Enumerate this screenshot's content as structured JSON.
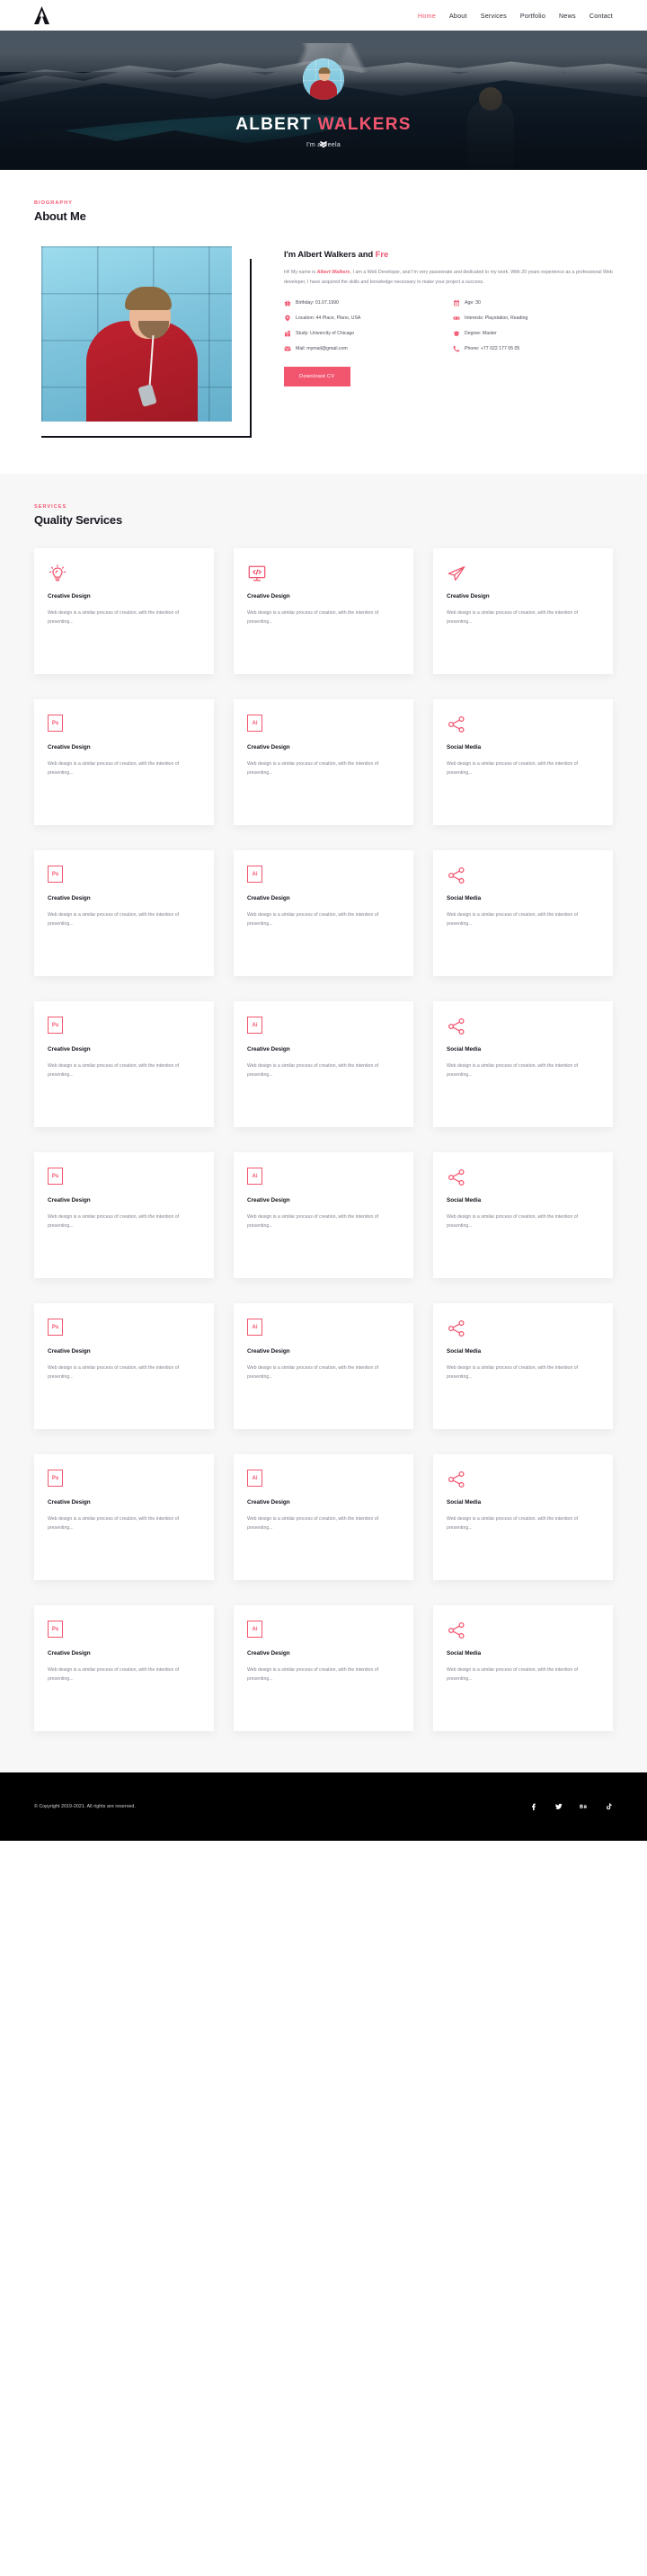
{
  "nav": {
    "logo_icon": "letter-a-logo-icon",
    "links": [
      {
        "label": "Home",
        "active": true
      },
      {
        "label": "About",
        "active": false
      },
      {
        "label": "Services",
        "active": false
      },
      {
        "label": "Portfolio",
        "active": false
      },
      {
        "label": "News",
        "active": false
      },
      {
        "label": "Contact",
        "active": false
      }
    ]
  },
  "hero": {
    "avatar_alt": "portrait-avatar",
    "title_first": "ALBERT ",
    "title_accent": "WALKERS",
    "subtitle": "I'm aFreela",
    "scroll_icon": "chevron-double-down-icon"
  },
  "about": {
    "eyebrow": "BIOGRAPHY",
    "title": "About Me",
    "heading_plain": "I'm Albert Walkers and ",
    "heading_accent": "Fre",
    "paragraph_lead": "Hi! My name is ",
    "paragraph_name": "Albert Walkers",
    "paragraph_rest": ", I am a Web Developer, and I'm very passionate and dedicated to my work. With 20 years experience as a professional Web developer, I have acquired the skills and knowledge necessary to make your project a success.",
    "info": [
      {
        "icon": "gift-icon",
        "label": "Birthday: 01.07.1990"
      },
      {
        "icon": "calendar-icon",
        "label": "Age: 30"
      },
      {
        "icon": "map-pin-icon",
        "label": "Location: 44 Place, Plano, USA"
      },
      {
        "icon": "gamepad-icon",
        "label": "Interests: Playstation, Reading"
      },
      {
        "icon": "building-icon",
        "label": "Study: Univercity of Chicago"
      },
      {
        "icon": "graduation-cap-icon",
        "label": "Degree: Master"
      },
      {
        "icon": "envelope-icon",
        "label": "Mail: mymail@gmail.com"
      },
      {
        "icon": "phone-icon",
        "label": "Phone: +77 022 177 05 05"
      }
    ],
    "cv_button": "Downlowd CV"
  },
  "services": {
    "eyebrow": "SERVICES",
    "title": "Quality Services",
    "rows": [
      [
        {
          "icon": "lightbulb-icon",
          "title": "Creative Design",
          "text": "Web design is a similar process of creation, with the intention of presenting..."
        },
        {
          "icon": "code-monitor-icon",
          "title": "Creative Design",
          "text": "Web design is a similar process of creation, with the intention of presenting..."
        },
        {
          "icon": "paper-plane-icon",
          "title": "Creative Design",
          "text": "Web design is a similar process of creation, with the intention of presenting..."
        }
      ],
      [
        {
          "icon": "photoshop-icon",
          "title": "Creative Design",
          "text": "Web design is a similar process of creation, with the intention of presenting..."
        },
        {
          "icon": "illustrator-icon",
          "title": "Creative Design",
          "text": "Web design is a similar process of creation, with the intention of presenting..."
        },
        {
          "icon": "share-icon",
          "title": "Social Media",
          "text": "Web design is a similar process of creation, with the intention of presenting..."
        }
      ],
      [
        {
          "icon": "photoshop-icon",
          "title": "Creative Design",
          "text": "Web design is a similar process of creation, with the intention of presenting..."
        },
        {
          "icon": "illustrator-icon",
          "title": "Creative Design",
          "text": "Web design is a similar process of creation, with the intention of presenting..."
        },
        {
          "icon": "share-icon",
          "title": "Social Media",
          "text": "Web design is a similar process of creation, with the intention of presenting..."
        }
      ],
      [
        {
          "icon": "photoshop-icon",
          "title": "Creative Design",
          "text": "Web design is a similar process of creation, with the intention of presenting..."
        },
        {
          "icon": "illustrator-icon",
          "title": "Creative Design",
          "text": "Web design is a similar process of creation, with the intention of presenting..."
        },
        {
          "icon": "share-icon",
          "title": "Social Media",
          "text": "Web design is a similar process of creation, with the intention of presenting..."
        }
      ],
      [
        {
          "icon": "photoshop-icon",
          "title": "Creative Design",
          "text": "Web design is a similar process of creation, with the intention of presenting..."
        },
        {
          "icon": "illustrator-icon",
          "title": "Creative Design",
          "text": "Web design is a similar process of creation, with the intention of presenting..."
        },
        {
          "icon": "share-icon",
          "title": "Social Media",
          "text": "Web design is a similar process of creation, with the intention of presenting..."
        }
      ],
      [
        {
          "icon": "photoshop-icon",
          "title": "Creative Design",
          "text": "Web design is a similar process of creation, with the intention of presenting..."
        },
        {
          "icon": "illustrator-icon",
          "title": "Creative Design",
          "text": "Web design is a similar process of creation, with the intention of presenting..."
        },
        {
          "icon": "share-icon",
          "title": "Social Media",
          "text": "Web design is a similar process of creation, with the intention of presenting..."
        }
      ],
      [
        {
          "icon": "photoshop-icon",
          "title": "Creative Design",
          "text": "Web design is a similar process of creation, with the intention of presenting..."
        },
        {
          "icon": "illustrator-icon",
          "title": "Creative Design",
          "text": "Web design is a similar process of creation, with the intention of presenting..."
        },
        {
          "icon": "share-icon",
          "title": "Social Media",
          "text": "Web design is a similar process of creation, with the intention of presenting..."
        }
      ],
      [
        {
          "icon": "photoshop-icon",
          "title": "Creative Design",
          "text": "Web design is a similar process of creation, with the intention of presenting..."
        },
        {
          "icon": "illustrator-icon",
          "title": "Creative Design",
          "text": "Web design is a similar process of creation, with the intention of presenting..."
        },
        {
          "icon": "share-icon",
          "title": "Social Media",
          "text": "Web design is a similar process of creation, with the intention of presenting..."
        }
      ]
    ]
  },
  "footer": {
    "copyright": "© Copyright 2019-2021. All rights are reserved.",
    "socials": [
      {
        "icon": "facebook-icon",
        "label": "f"
      },
      {
        "icon": "twitter-icon",
        "label": "t"
      },
      {
        "icon": "behance-icon",
        "label": "Bē"
      },
      {
        "icon": "tiktok-icon",
        "label": "d"
      }
    ]
  },
  "colors": {
    "accent": "#f2566f",
    "dark": "#17171f",
    "muted": "#80848e",
    "services_bg": "#f7f7f8",
    "footer_bg": "#000000"
  }
}
